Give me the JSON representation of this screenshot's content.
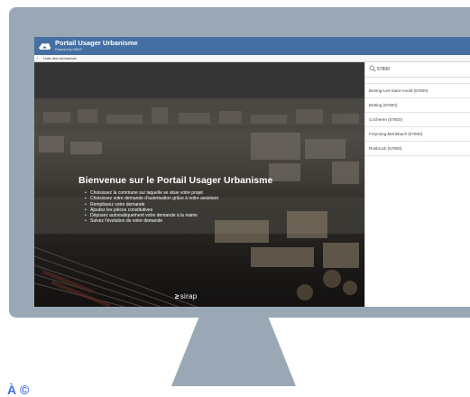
{
  "app": {
    "title": "Portail Usager Urbanisme",
    "subtitle": "Powered by SIRAP"
  },
  "subbar": {
    "chevron_icon": "chevron-left-icon",
    "label": "Liste des communes"
  },
  "hero": {
    "heading": "Bienvenue sur le Portail Usager Urbanisme",
    "bullets": [
      "Choisissez la commune sur laquelle se situe votre projet",
      "Choisissez votre demande d'autorisation grâce à notre assistant",
      "Remplissez votre demande",
      "Ajoutez les pièces constitutives",
      "Déposez automatiquement votre demande à la mairie",
      "Suivez l'évolution de votre demande"
    ],
    "brand": "sirap"
  },
  "search": {
    "icon": "search-icon",
    "value": "57800",
    "placeholder": ""
  },
  "results": [
    "Bening-Les-Saint-Avold (57800)",
    "Betting (57800)",
    "Cocheren (57800)",
    "Freyming-Merlebach (57800)",
    "Rosbruck (57800)"
  ],
  "footer_text": "À ©",
  "colors": {
    "appbar": "#456fa3",
    "monitor": "#9aa8b5",
    "footer_text": "#3f6fe0"
  }
}
